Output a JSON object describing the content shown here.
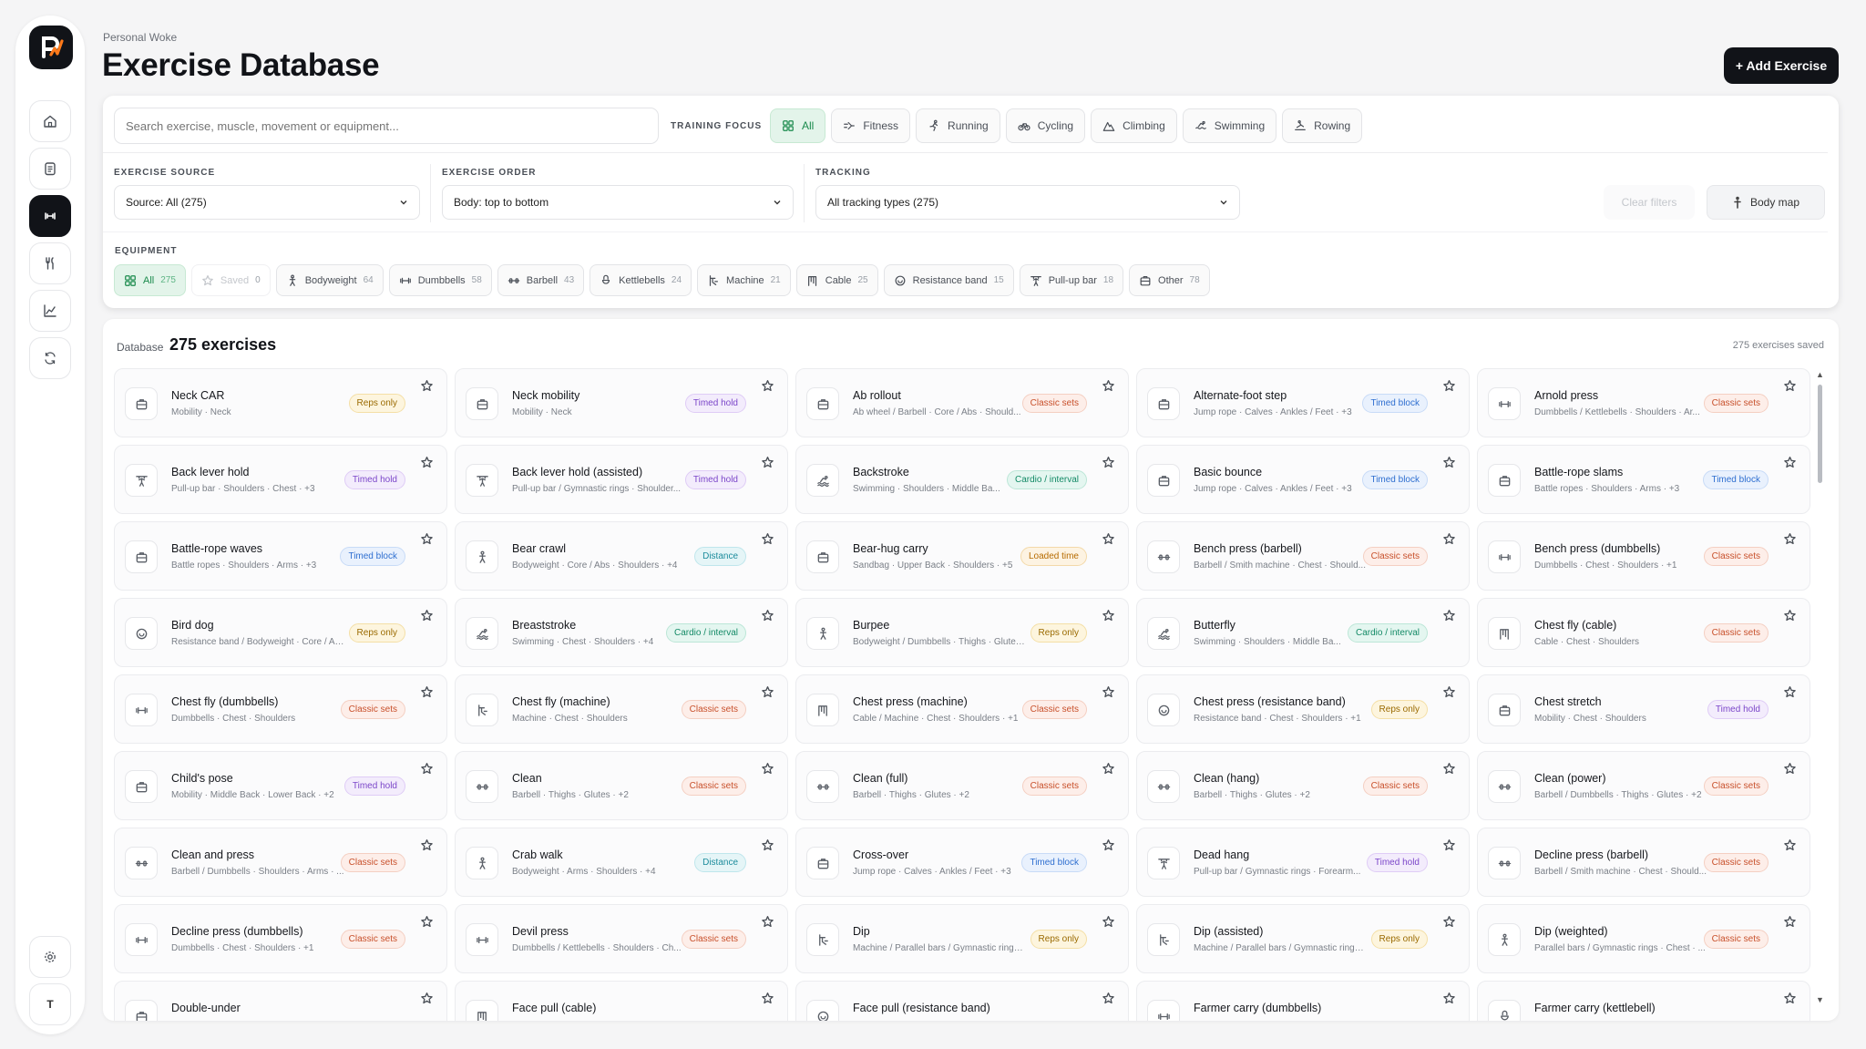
{
  "app": {
    "breadcrumb": "Personal Woke",
    "title": "Exercise Database",
    "add_button": "+ Add Exercise"
  },
  "sidebar": {
    "items": [
      {
        "name": "home-icon"
      },
      {
        "name": "clipboard-icon"
      },
      {
        "name": "dumbbell-icon",
        "active": true
      },
      {
        "name": "utensils-icon"
      },
      {
        "name": "chart-icon"
      },
      {
        "name": "sync-icon"
      }
    ],
    "settings_icon": "gear-icon",
    "avatar": "T"
  },
  "search": {
    "placeholder": "Search exercise, muscle, movement or equipment..."
  },
  "training_focus": {
    "label": "TRAINING FOCUS",
    "options": [
      {
        "label": "All",
        "icon": "grid-icon",
        "active": true
      },
      {
        "label": "Fitness",
        "icon": "fitness-icon"
      },
      {
        "label": "Running",
        "icon": "running-icon"
      },
      {
        "label": "Cycling",
        "icon": "bike-icon"
      },
      {
        "label": "Climbing",
        "icon": "mountain-icon"
      },
      {
        "label": "Swimming",
        "icon": "swimming-icon"
      },
      {
        "label": "Rowing",
        "icon": "rowing-icon"
      }
    ]
  },
  "filters": {
    "source": {
      "label": "EXERCISE SOURCE",
      "value": "Source: All (275)"
    },
    "order": {
      "label": "EXERCISE ORDER",
      "value": "Body: top to bottom"
    },
    "tracking": {
      "label": "TRACKING",
      "value": "All tracking types (275)"
    },
    "clear": "Clear filters",
    "body_map": "Body map"
  },
  "equipment": {
    "label": "EQUIPMENT",
    "options": [
      {
        "label": "All",
        "count": "275",
        "icon": "grid",
        "active": true
      },
      {
        "label": "Saved",
        "count": "0",
        "icon": "star",
        "dim": true
      },
      {
        "label": "Bodyweight",
        "count": "64",
        "icon": "person"
      },
      {
        "label": "Dumbbells",
        "count": "58",
        "icon": "dumbbell"
      },
      {
        "label": "Barbell",
        "count": "43",
        "icon": "barbell"
      },
      {
        "label": "Kettlebells",
        "count": "24",
        "icon": "kettlebell"
      },
      {
        "label": "Machine",
        "count": "21",
        "icon": "machine"
      },
      {
        "label": "Cable",
        "count": "25",
        "icon": "cable"
      },
      {
        "label": "Resistance band",
        "count": "15",
        "icon": "band"
      },
      {
        "label": "Pull-up bar",
        "count": "18",
        "icon": "pullup"
      },
      {
        "label": "Other",
        "count": "78",
        "icon": "box"
      }
    ]
  },
  "list": {
    "db_label": "Database",
    "count_label": "275 exercises",
    "saved_label": "275 exercises saved"
  },
  "exercises": [
    {
      "name": "Neck CAR",
      "meta": "Mobility · Neck",
      "badge": "Reps only",
      "kind": "reps",
      "icon": "box"
    },
    {
      "name": "Neck mobility",
      "meta": "Mobility · Neck",
      "badge": "Timed hold",
      "kind": "timedhold",
      "icon": "box"
    },
    {
      "name": "Ab rollout",
      "meta": "Ab wheel / Barbell · Core / Abs · Should...",
      "badge": "Classic sets",
      "kind": "classic",
      "icon": "box"
    },
    {
      "name": "Alternate-foot step",
      "meta": "Jump rope · Calves · Ankles / Feet · +3",
      "badge": "Timed block",
      "kind": "timedblock",
      "icon": "box"
    },
    {
      "name": "Arnold press",
      "meta": "Dumbbells / Kettlebells · Shoulders · Ar...",
      "badge": "Classic sets",
      "kind": "classic",
      "icon": "dumbbell"
    },
    {
      "name": "Back lever hold",
      "meta": "Pull-up bar · Shoulders · Chest · +3",
      "badge": "Timed hold",
      "kind": "timedhold",
      "icon": "pullup"
    },
    {
      "name": "Back lever hold (assisted)",
      "meta": "Pull-up bar / Gymnastic rings · Shoulder...",
      "badge": "Timed hold",
      "kind": "timedhold",
      "icon": "pullup"
    },
    {
      "name": "Backstroke",
      "meta": "Swimming · Shoulders · Middle Ba...",
      "badge": "Cardio / interval",
      "kind": "cardio",
      "icon": "swim"
    },
    {
      "name": "Basic bounce",
      "meta": "Jump rope · Calves · Ankles / Feet · +3",
      "badge": "Timed block",
      "kind": "timedblock",
      "icon": "box"
    },
    {
      "name": "Battle-rope slams",
      "meta": "Battle ropes · Shoulders · Arms · +3",
      "badge": "Timed block",
      "kind": "timedblock",
      "icon": "box"
    },
    {
      "name": "Battle-rope waves",
      "meta": "Battle ropes · Shoulders · Arms · +3",
      "badge": "Timed block",
      "kind": "timedblock",
      "icon": "box"
    },
    {
      "name": "Bear crawl",
      "meta": "Bodyweight · Core / Abs · Shoulders · +4",
      "badge": "Distance",
      "kind": "distance",
      "icon": "person"
    },
    {
      "name": "Bear-hug carry",
      "meta": "Sandbag · Upper Back · Shoulders · +5",
      "badge": "Loaded time",
      "kind": "loaded",
      "icon": "box"
    },
    {
      "name": "Bench press (barbell)",
      "meta": "Barbell / Smith machine · Chest · Should...",
      "badge": "Classic sets",
      "kind": "classic",
      "icon": "barbell"
    },
    {
      "name": "Bench press (dumbbells)",
      "meta": "Dumbbells · Chest · Shoulders · +1",
      "badge": "Classic sets",
      "kind": "classic",
      "icon": "dumbbell"
    },
    {
      "name": "Bird dog",
      "meta": "Resistance band / Bodyweight · Core / Ab...",
      "badge": "Reps only",
      "kind": "reps",
      "icon": "band"
    },
    {
      "name": "Breaststroke",
      "meta": "Swimming · Chest · Shoulders · +4",
      "badge": "Cardio / interval",
      "kind": "cardio",
      "icon": "swim"
    },
    {
      "name": "Burpee",
      "meta": "Bodyweight / Dumbbells · Thighs · Glutes...",
      "badge": "Reps only",
      "kind": "reps",
      "icon": "person"
    },
    {
      "name": "Butterfly",
      "meta": "Swimming · Shoulders · Middle Ba...",
      "badge": "Cardio / interval",
      "kind": "cardio",
      "icon": "swim"
    },
    {
      "name": "Chest fly (cable)",
      "meta": "Cable · Chest · Shoulders",
      "badge": "Classic sets",
      "kind": "classic",
      "icon": "cable"
    },
    {
      "name": "Chest fly (dumbbells)",
      "meta": "Dumbbells · Chest · Shoulders",
      "badge": "Classic sets",
      "kind": "classic",
      "icon": "dumbbell"
    },
    {
      "name": "Chest fly (machine)",
      "meta": "Machine · Chest · Shoulders",
      "badge": "Classic sets",
      "kind": "classic",
      "icon": "machine"
    },
    {
      "name": "Chest press (machine)",
      "meta": "Cable / Machine · Chest · Shoulders · +1",
      "badge": "Classic sets",
      "kind": "classic",
      "icon": "cable"
    },
    {
      "name": "Chest press (resistance band)",
      "meta": "Resistance band · Chest · Shoulders · +1",
      "badge": "Reps only",
      "kind": "reps",
      "icon": "band"
    },
    {
      "name": "Chest stretch",
      "meta": "Mobility · Chest · Shoulders",
      "badge": "Timed hold",
      "kind": "timedhold",
      "icon": "box"
    },
    {
      "name": "Child's pose",
      "meta": "Mobility · Middle Back · Lower Back · +2",
      "badge": "Timed hold",
      "kind": "timedhold",
      "icon": "box"
    },
    {
      "name": "Clean",
      "meta": "Barbell · Thighs · Glutes · +2",
      "badge": "Classic sets",
      "kind": "classic",
      "icon": "barbell"
    },
    {
      "name": "Clean (full)",
      "meta": "Barbell · Thighs · Glutes · +2",
      "badge": "Classic sets",
      "kind": "classic",
      "icon": "barbell"
    },
    {
      "name": "Clean (hang)",
      "meta": "Barbell · Thighs · Glutes · +2",
      "badge": "Classic sets",
      "kind": "classic",
      "icon": "barbell"
    },
    {
      "name": "Clean (power)",
      "meta": "Barbell / Dumbbells · Thighs · Glutes · +2",
      "badge": "Classic sets",
      "kind": "classic",
      "icon": "barbell"
    },
    {
      "name": "Clean and press",
      "meta": "Barbell / Dumbbells · Shoulders · Arms · ...",
      "badge": "Classic sets",
      "kind": "classic",
      "icon": "barbell"
    },
    {
      "name": "Crab walk",
      "meta": "Bodyweight · Arms · Shoulders · +4",
      "badge": "Distance",
      "kind": "distance",
      "icon": "person"
    },
    {
      "name": "Cross-over",
      "meta": "Jump rope · Calves · Ankles / Feet · +3",
      "badge": "Timed block",
      "kind": "timedblock",
      "icon": "box"
    },
    {
      "name": "Dead hang",
      "meta": "Pull-up bar / Gymnastic rings · Forearm...",
      "badge": "Timed hold",
      "kind": "timedhold",
      "icon": "pullup"
    },
    {
      "name": "Decline press (barbell)",
      "meta": "Barbell / Smith machine · Chest · Should...",
      "badge": "Classic sets",
      "kind": "classic",
      "icon": "barbell"
    },
    {
      "name": "Decline press (dumbbells)",
      "meta": "Dumbbells · Chest · Shoulders · +1",
      "badge": "Classic sets",
      "kind": "classic",
      "icon": "dumbbell"
    },
    {
      "name": "Devil press",
      "meta": "Dumbbells / Kettlebells · Shoulders · Ch...",
      "badge": "Classic sets",
      "kind": "classic",
      "icon": "dumbbell"
    },
    {
      "name": "Dip",
      "meta": "Machine / Parallel bars / Gymnastic rings ...",
      "badge": "Reps only",
      "kind": "reps",
      "icon": "machine"
    },
    {
      "name": "Dip (assisted)",
      "meta": "Machine / Parallel bars / Gymnastic rings ...",
      "badge": "Reps only",
      "kind": "reps",
      "icon": "machine"
    },
    {
      "name": "Dip (weighted)",
      "meta": "Parallel bars / Gymnastic rings · Chest · ...",
      "badge": "Classic sets",
      "kind": "classic",
      "icon": "person"
    },
    {
      "name": "Double-under",
      "meta": "",
      "badge": "",
      "kind": "reps",
      "icon": "box"
    },
    {
      "name": "Face pull (cable)",
      "meta": "",
      "badge": "",
      "kind": "classic",
      "icon": "cable"
    },
    {
      "name": "Face pull (resistance band)",
      "meta": "",
      "badge": "",
      "kind": "reps",
      "icon": "band"
    },
    {
      "name": "Farmer carry (dumbbells)",
      "meta": "",
      "badge": "",
      "kind": "loaded",
      "icon": "dumbbell"
    },
    {
      "name": "Farmer carry (kettlebell)",
      "meta": "",
      "badge": "",
      "kind": "loaded",
      "icon": "kettlebell"
    }
  ]
}
